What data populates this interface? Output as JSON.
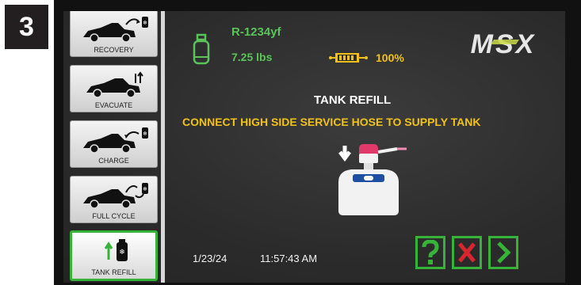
{
  "step": {
    "number": "3"
  },
  "sidebar": {
    "items": [
      {
        "label": "RECOVERY",
        "icon": "car-recovery-icon",
        "active": false
      },
      {
        "label": "EVACUATE",
        "icon": "car-evacuate-icon",
        "active": false
      },
      {
        "label": "CHARGE",
        "icon": "car-charge-icon",
        "active": false
      },
      {
        "label": "FULL CYCLE",
        "icon": "car-full-cycle-icon",
        "active": false
      },
      {
        "label": "TANK REFILL",
        "icon": "tank-refill-icon",
        "active": true
      }
    ]
  },
  "status": {
    "refrigerant": "R-1234yf",
    "weight": "7.25 lbs",
    "battery_percent": "100%",
    "brand": "MSX"
  },
  "main": {
    "title": "TANK REFILL",
    "instruction": "CONNECT HIGH SIDE SERVICE HOSE TO SUPPLY TANK"
  },
  "footer": {
    "date": "1/23/24",
    "time": "11:57:43 AM",
    "buttons": [
      {
        "name": "help",
        "symbol": "?"
      },
      {
        "name": "cancel",
        "symbol": "X"
      },
      {
        "name": "next",
        "symbol": ">"
      }
    ]
  },
  "colors": {
    "accent_green": "#37b33a",
    "text_green": "#5cc25b",
    "warning_yellow": "#f2c21a",
    "cancel_red": "#d8262e",
    "screen_bg": "#2b2b2b"
  }
}
